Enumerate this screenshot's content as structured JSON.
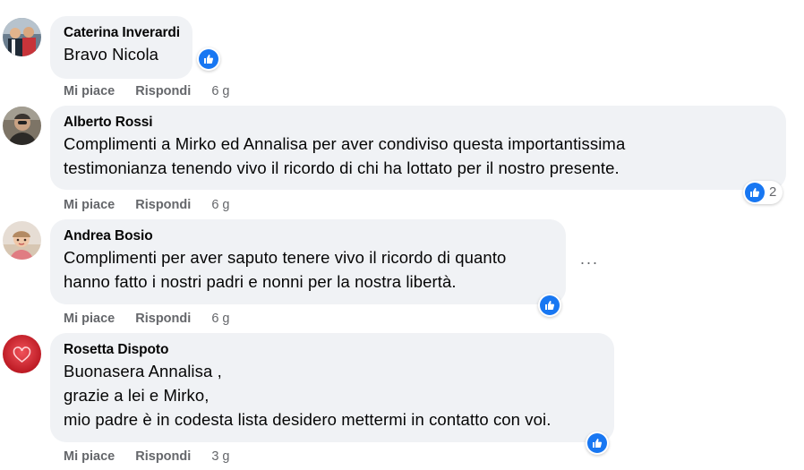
{
  "comments": [
    {
      "author": "Caterina Inverardi",
      "lines": [
        "Bravo Nicola"
      ],
      "actions": {
        "like": "Mi piace",
        "reply": "Rispondi",
        "time": "6 g"
      },
      "reaction": {
        "icon": "like-icon",
        "count": ""
      }
    },
    {
      "author": "Alberto Rossi",
      "lines": [
        "Complimenti a Mirko ed Annalisa per aver condiviso questa importantissima",
        "testimonianza tenendo vivo il ricordo di chi ha lottato per il nostro presente."
      ],
      "actions": {
        "like": "Mi piace",
        "reply": "Rispondi",
        "time": "6 g"
      },
      "reaction": {
        "icon": "like-icon",
        "count": "2"
      }
    },
    {
      "author": "Andrea Bosio",
      "lines": [
        "Complimenti per aver saputo tenere vivo il ricordo di quanto",
        "hanno fatto i nostri padri e nonni per la nostra libertà."
      ],
      "actions": {
        "like": "Mi piace",
        "reply": "Rispondi",
        "time": "6 g"
      },
      "reaction": {
        "icon": "like-icon",
        "count": ""
      },
      "more": "···"
    },
    {
      "author": "Rosetta Dispoto",
      "lines": [
        "Buonasera Annalisa ,",
        "grazie a lei e Mirko,",
        "mio padre è in codesta lista desidero mettermi in contatto con voi."
      ],
      "actions": {
        "like": "Mi piace",
        "reply": "Rispondi",
        "time": "3 g"
      },
      "reaction": {
        "icon": "like-icon",
        "count": ""
      }
    }
  ],
  "colors": {
    "bubble": "#f0f2f5",
    "like_blue": "#1877f2",
    "secondary_text": "#65676b",
    "primary_text": "#050505"
  }
}
